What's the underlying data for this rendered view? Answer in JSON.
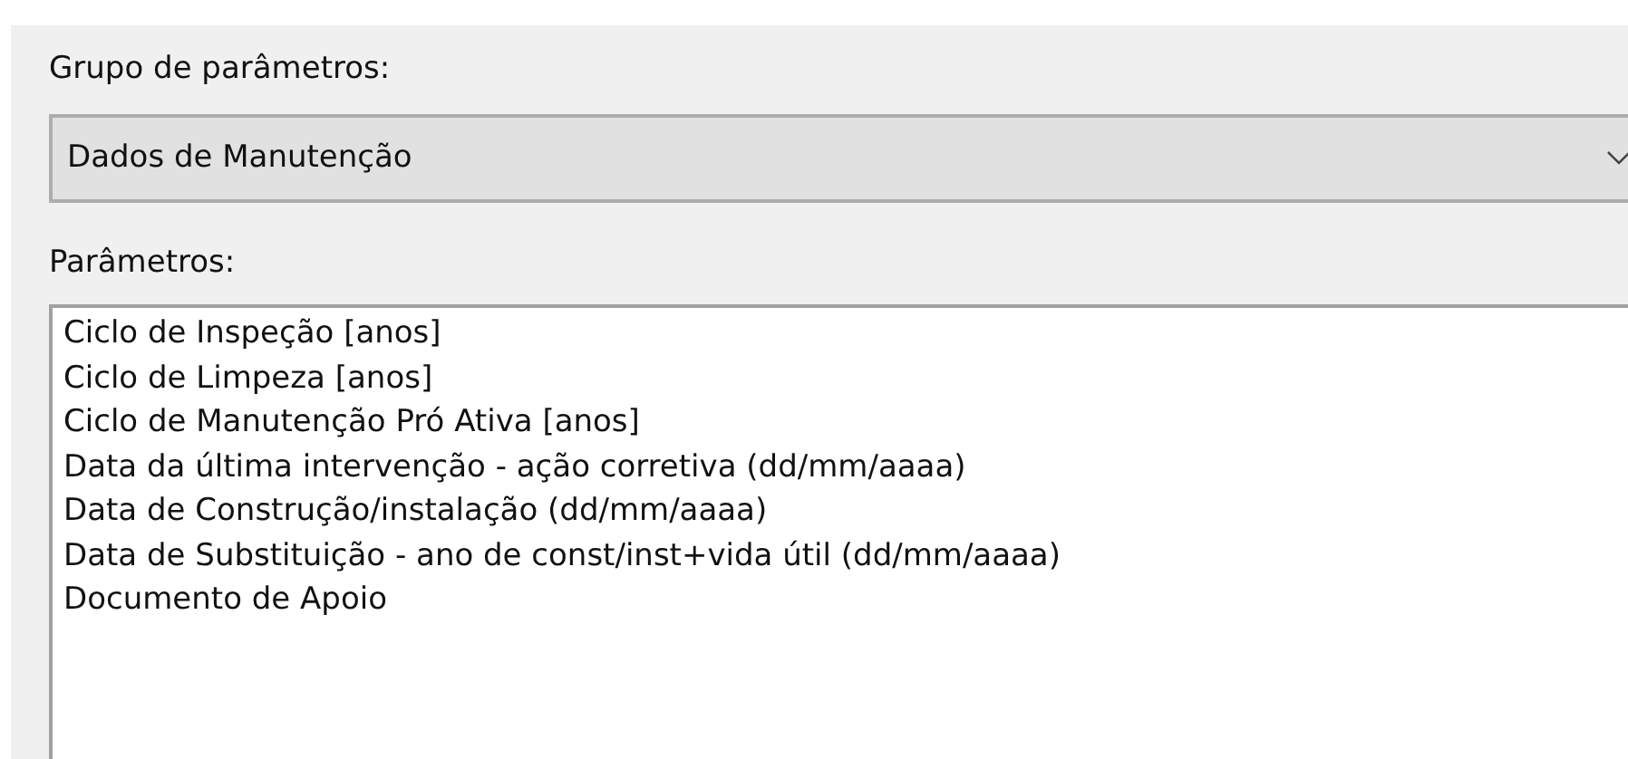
{
  "group_label": "Grupo de parâmetros:",
  "group_select": {
    "value": "Dados de Manutenção"
  },
  "params_label": "Parâmetros:",
  "params": [
    {
      "label": "Ciclo de Inspeção [anos]",
      "selected": false
    },
    {
      "label": "Ciclo de Limpeza [anos]",
      "selected": false
    },
    {
      "label": "Ciclo de Manutenção Pró Ativa [anos]",
      "selected": false
    },
    {
      "label": "Data da última intervenção - ação corretiva (dd/mm/aaaa)",
      "selected": false
    },
    {
      "label": "Data de Construção/instalação (dd/mm/aaaa)",
      "selected": false
    },
    {
      "label": "Data de Substituição - ano de const/inst+vida útil (dd/mm/aaaa)",
      "selected": false
    },
    {
      "label": "Documento de Apoio",
      "selected": false
    }
  ]
}
